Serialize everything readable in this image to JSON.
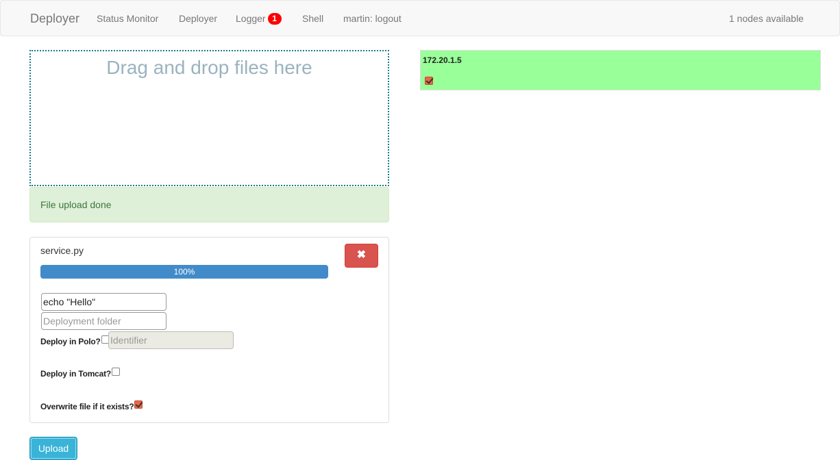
{
  "navbar": {
    "brand": "Deployer",
    "links": [
      {
        "label": "Status Monitor"
      },
      {
        "label": "Deployer"
      },
      {
        "label": "Logger",
        "badge": "1"
      },
      {
        "label": "Shell"
      },
      {
        "label": "martin: logout"
      }
    ],
    "nodes_available": "1 nodes available"
  },
  "dropzone": {
    "text": "Drag and drop files here"
  },
  "alert": {
    "text": "File upload done"
  },
  "file": {
    "name": "service.py",
    "remove_icon": "times-icon",
    "remove_glyph": "✖",
    "progress_percent": 100,
    "progress_label": "100%",
    "command_value": "echo \"Hello\"",
    "folder_placeholder": "Deployment folder",
    "polo_label": "Deploy in Polo?",
    "polo_checked": false,
    "identifier_placeholder": "Identifier",
    "tomcat_label": "Deploy in Tomcat?",
    "tomcat_checked": false,
    "overwrite_label": "Overwrite file if it exists?",
    "overwrite_checked": true
  },
  "upload_button": "Upload",
  "nodes": [
    {
      "ip": "172.20.1.5",
      "selected": true,
      "color": "#99ff99"
    }
  ],
  "colors": {
    "success_bg": "#dff0d8",
    "danger": "#d9534f",
    "progress": "#428bca",
    "info": "#39b3d7"
  }
}
